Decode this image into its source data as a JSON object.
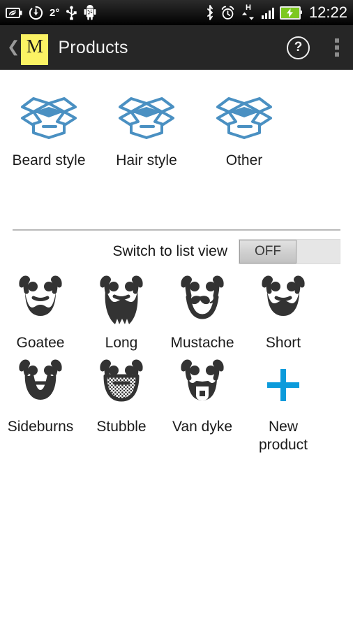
{
  "statusbar": {
    "left_icons": [
      "eco-battery-icon",
      "download-sync-icon",
      "usb-icon",
      "android-robot-icon"
    ],
    "temperature": "2°",
    "right_icons": [
      "bluetooth-icon",
      "alarm-icon",
      "hspa-data-icon",
      "signal-bars-icon",
      "battery-charging-icon"
    ],
    "network_type": "H",
    "clock": "12:22"
  },
  "actionbar": {
    "back_label": "❮",
    "logo_letter": "M",
    "title": "Products",
    "help_label": "?",
    "overflow_label": "⋮"
  },
  "categories": [
    {
      "label": "Beard style",
      "icon": "open-box-icon"
    },
    {
      "label": "Hair style",
      "icon": "open-box-icon"
    },
    {
      "label": "Other",
      "icon": "open-box-icon"
    }
  ],
  "list_view": {
    "label": "Switch to list view",
    "toggle_state": "OFF"
  },
  "products": [
    {
      "label": "Goatee",
      "icon": "beard-goatee-icon"
    },
    {
      "label": "Long",
      "icon": "beard-long-icon"
    },
    {
      "label": "Mustache",
      "icon": "beard-mustache-icon"
    },
    {
      "label": "Short",
      "icon": "beard-short-icon"
    },
    {
      "label": "Sideburns",
      "icon": "beard-sideburns-icon"
    },
    {
      "label": "Stubble",
      "icon": "beard-stubble-icon"
    },
    {
      "label": "Van dyke",
      "icon": "beard-vandyke-icon"
    }
  ],
  "new_product": {
    "label": "New\nproduct",
    "line1": "New",
    "line2": "product",
    "icon": "plus-icon"
  },
  "colors": {
    "accent_blue": "#4a90c2",
    "plus_blue": "#0c9bdb",
    "logo_yellow": "#fbf264",
    "actionbar_bg": "#262626",
    "icon_dark": "#333333",
    "battery_green": "#7dc820"
  }
}
